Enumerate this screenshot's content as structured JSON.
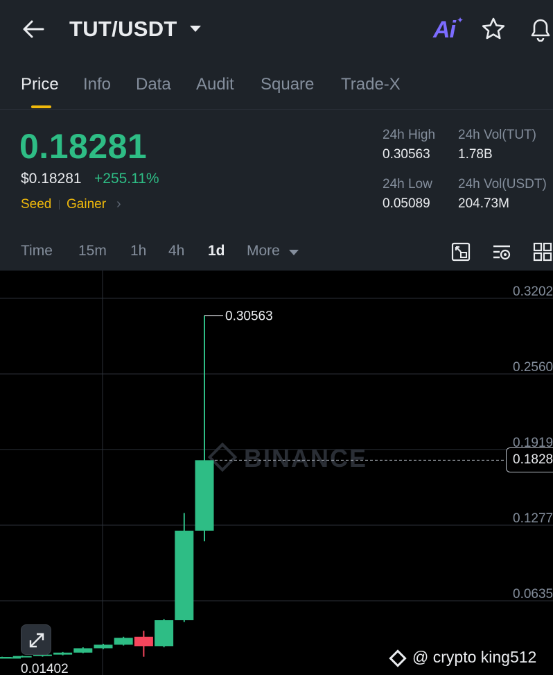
{
  "header": {
    "pair": "TUT/USDT",
    "back_icon": "arrow-left-icon",
    "ai_label": "Ai",
    "star_icon": "star-icon",
    "bell_icon": "bell-icon"
  },
  "tabs": [
    {
      "label": "Price",
      "active": true
    },
    {
      "label": "Info",
      "active": false
    },
    {
      "label": "Data",
      "active": false
    },
    {
      "label": "Audit",
      "active": false
    },
    {
      "label": "Square",
      "active": false
    },
    {
      "label": "Trade-X",
      "active": false
    }
  ],
  "ticker": {
    "last_price": "0.18281",
    "usd_price": "$0.18281",
    "change": "+255.11%",
    "tag_seed": "Seed",
    "tag_gainer": "Gainer",
    "stats": {
      "high_label": "24h High",
      "high_value": "0.30563",
      "vol_base_label": "24h Vol(TUT)",
      "vol_base_value": "1.78B",
      "low_label": "24h Low",
      "low_value": "0.05089",
      "vol_quote_label": "24h Vol(USDT)",
      "vol_quote_value": "204.73M"
    }
  },
  "intervals": {
    "items": [
      {
        "label": "Time",
        "active": false
      },
      {
        "label": "15m",
        "active": false
      },
      {
        "label": "1h",
        "active": false
      },
      {
        "label": "4h",
        "active": false
      },
      {
        "label": "1d",
        "active": true
      },
      {
        "label": "More",
        "active": false
      }
    ],
    "tools": [
      "chart-settings-icon",
      "indicator-settings-icon",
      "layout-grid-icon"
    ]
  },
  "chart": {
    "watermark": "BINANCE",
    "current_price_label": "0.1828",
    "high_marker": "0.30563",
    "low_marker": "0.01402",
    "credit": "@ crypto king512",
    "colors": {
      "up": "#2ebd85",
      "down": "#f6465d",
      "background": "#000000",
      "grid": "#2b3139"
    }
  },
  "chart_data": {
    "type": "candlestick",
    "y_axis_labels": [
      "0.3202",
      "0.2560",
      "0.1919",
      "0.1277",
      "0.0635"
    ],
    "ylim": [
      0.0,
      0.34
    ],
    "current_price": 0.18281,
    "candles": [
      {
        "open": 0.0148,
        "high": 0.0152,
        "low": 0.014,
        "close": 0.015
      },
      {
        "open": 0.015,
        "high": 0.016,
        "low": 0.0146,
        "close": 0.0158
      },
      {
        "open": 0.0158,
        "high": 0.017,
        "low": 0.0154,
        "close": 0.0166
      },
      {
        "open": 0.0166,
        "high": 0.0185,
        "low": 0.016,
        "close": 0.0178
      },
      {
        "open": 0.0178,
        "high": 0.02,
        "low": 0.0172,
        "close": 0.0195
      },
      {
        "open": 0.0195,
        "high": 0.024,
        "low": 0.019,
        "close": 0.0232
      },
      {
        "open": 0.0232,
        "high": 0.027,
        "low": 0.0225,
        "close": 0.0262
      },
      {
        "open": 0.0262,
        "high": 0.033,
        "low": 0.0255,
        "close": 0.032
      },
      {
        "open": 0.033,
        "high": 0.038,
        "low": 0.016,
        "close": 0.025
      },
      {
        "open": 0.025,
        "high": 0.048,
        "low": 0.024,
        "close": 0.047
      },
      {
        "open": 0.047,
        "high": 0.138,
        "low": 0.0455,
        "close": 0.123
      },
      {
        "open": 0.123,
        "high": 0.30563,
        "low": 0.114,
        "close": 0.18281
      }
    ]
  }
}
